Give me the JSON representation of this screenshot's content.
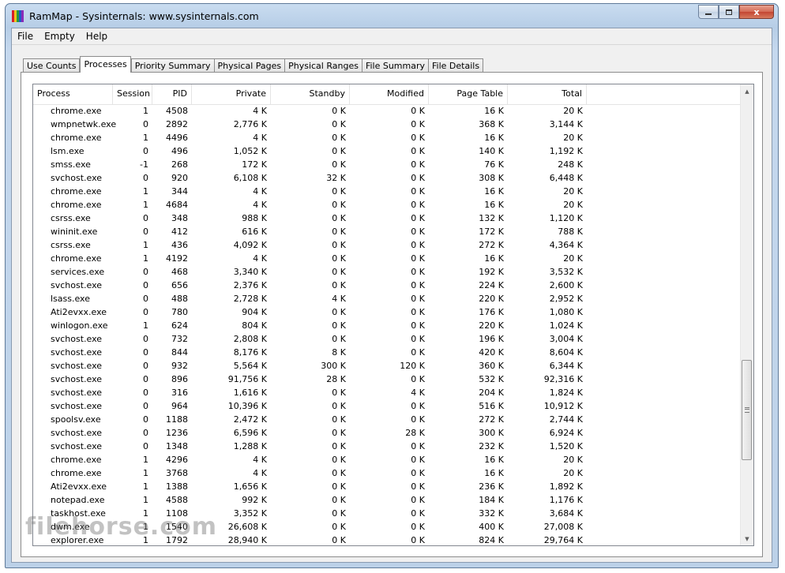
{
  "window": {
    "title": "RamMap - Sysinternals: www.sysinternals.com"
  },
  "caption": {
    "close_glyph": "x"
  },
  "menu": [
    "File",
    "Empty",
    "Help"
  ],
  "tabs": [
    "Use Counts",
    "Processes",
    "Priority Summary",
    "Physical Pages",
    "Physical Ranges",
    "File Summary",
    "File Details"
  ],
  "active_tab": 1,
  "columns": [
    "Process",
    "Session",
    "PID",
    "Private",
    "Standby",
    "Modified",
    "Page Table",
    "Total"
  ],
  "rows": [
    [
      "chrome.exe",
      "1",
      "4508",
      "4 K",
      "0 K",
      "0 K",
      "16 K",
      "20 K"
    ],
    [
      "wmpnetwk.exe",
      "0",
      "2892",
      "2,776 K",
      "0 K",
      "0 K",
      "368 K",
      "3,144 K"
    ],
    [
      "chrome.exe",
      "1",
      "4496",
      "4 K",
      "0 K",
      "0 K",
      "16 K",
      "20 K"
    ],
    [
      "lsm.exe",
      "0",
      "496",
      "1,052 K",
      "0 K",
      "0 K",
      "140 K",
      "1,192 K"
    ],
    [
      "smss.exe",
      "-1",
      "268",
      "172 K",
      "0 K",
      "0 K",
      "76 K",
      "248 K"
    ],
    [
      "svchost.exe",
      "0",
      "920",
      "6,108 K",
      "32 K",
      "0 K",
      "308 K",
      "6,448 K"
    ],
    [
      "chrome.exe",
      "1",
      "344",
      "4 K",
      "0 K",
      "0 K",
      "16 K",
      "20 K"
    ],
    [
      "chrome.exe",
      "1",
      "4684",
      "4 K",
      "0 K",
      "0 K",
      "16 K",
      "20 K"
    ],
    [
      "csrss.exe",
      "0",
      "348",
      "988 K",
      "0 K",
      "0 K",
      "132 K",
      "1,120 K"
    ],
    [
      "wininit.exe",
      "0",
      "412",
      "616 K",
      "0 K",
      "0 K",
      "172 K",
      "788 K"
    ],
    [
      "csrss.exe",
      "1",
      "436",
      "4,092 K",
      "0 K",
      "0 K",
      "272 K",
      "4,364 K"
    ],
    [
      "chrome.exe",
      "1",
      "4192",
      "4 K",
      "0 K",
      "0 K",
      "16 K",
      "20 K"
    ],
    [
      "services.exe",
      "0",
      "468",
      "3,340 K",
      "0 K",
      "0 K",
      "192 K",
      "3,532 K"
    ],
    [
      "svchost.exe",
      "0",
      "656",
      "2,376 K",
      "0 K",
      "0 K",
      "224 K",
      "2,600 K"
    ],
    [
      "lsass.exe",
      "0",
      "488",
      "2,728 K",
      "4 K",
      "0 K",
      "220 K",
      "2,952 K"
    ],
    [
      "Ati2evxx.exe",
      "0",
      "780",
      "904 K",
      "0 K",
      "0 K",
      "176 K",
      "1,080 K"
    ],
    [
      "winlogon.exe",
      "1",
      "624",
      "804 K",
      "0 K",
      "0 K",
      "220 K",
      "1,024 K"
    ],
    [
      "svchost.exe",
      "0",
      "732",
      "2,808 K",
      "0 K",
      "0 K",
      "196 K",
      "3,004 K"
    ],
    [
      "svchost.exe",
      "0",
      "844",
      "8,176 K",
      "8 K",
      "0 K",
      "420 K",
      "8,604 K"
    ],
    [
      "svchost.exe",
      "0",
      "932",
      "5,564 K",
      "300 K",
      "120 K",
      "360 K",
      "6,344 K"
    ],
    [
      "svchost.exe",
      "0",
      "896",
      "91,756 K",
      "28 K",
      "0 K",
      "532 K",
      "92,316 K"
    ],
    [
      "svchost.exe",
      "0",
      "316",
      "1,616 K",
      "0 K",
      "4 K",
      "204 K",
      "1,824 K"
    ],
    [
      "svchost.exe",
      "0",
      "964",
      "10,396 K",
      "0 K",
      "0 K",
      "516 K",
      "10,912 K"
    ],
    [
      "spoolsv.exe",
      "0",
      "1188",
      "2,472 K",
      "0 K",
      "0 K",
      "272 K",
      "2,744 K"
    ],
    [
      "svchost.exe",
      "0",
      "1236",
      "6,596 K",
      "0 K",
      "28 K",
      "300 K",
      "6,924 K"
    ],
    [
      "svchost.exe",
      "0",
      "1348",
      "1,288 K",
      "0 K",
      "0 K",
      "232 K",
      "1,520 K"
    ],
    [
      "chrome.exe",
      "1",
      "4296",
      "4 K",
      "0 K",
      "0 K",
      "16 K",
      "20 K"
    ],
    [
      "chrome.exe",
      "1",
      "3768",
      "4 K",
      "0 K",
      "0 K",
      "16 K",
      "20 K"
    ],
    [
      "Ati2evxx.exe",
      "1",
      "1388",
      "1,656 K",
      "0 K",
      "0 K",
      "236 K",
      "1,892 K"
    ],
    [
      "notepad.exe",
      "1",
      "4588",
      "992 K",
      "0 K",
      "0 K",
      "184 K",
      "1,176 K"
    ],
    [
      "taskhost.exe",
      "1",
      "1108",
      "3,352 K",
      "0 K",
      "0 K",
      "332 K",
      "3,684 K"
    ],
    [
      "dwm.exe",
      "1",
      "1540",
      "26,608 K",
      "0 K",
      "0 K",
      "400 K",
      "27,008 K"
    ],
    [
      "explorer.exe",
      "1",
      "1792",
      "28,940 K",
      "0 K",
      "0 K",
      "824 K",
      "29,764 K"
    ]
  ],
  "watermark": "filehorse.com",
  "colors": {
    "icon_stripes": [
      "#d81e2a",
      "#f2c21b",
      "#2a9a3c",
      "#2456c8",
      "#8a2bb8"
    ]
  }
}
